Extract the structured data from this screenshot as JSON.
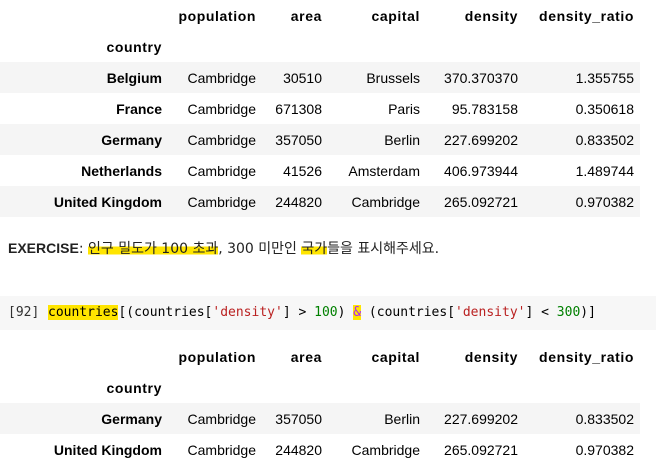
{
  "columns": [
    "population",
    "area",
    "capital",
    "density",
    "density_ratio"
  ],
  "index_name": "country",
  "table1": [
    {
      "country": "Belgium",
      "population": "Cambridge",
      "area": "30510",
      "capital": "Brussels",
      "density": "370.370370",
      "density_ratio": "1.355755"
    },
    {
      "country": "France",
      "population": "Cambridge",
      "area": "671308",
      "capital": "Paris",
      "density": "95.783158",
      "density_ratio": "0.350618"
    },
    {
      "country": "Germany",
      "population": "Cambridge",
      "area": "357050",
      "capital": "Berlin",
      "density": "227.699202",
      "density_ratio": "0.833502"
    },
    {
      "country": "Netherlands",
      "population": "Cambridge",
      "area": "41526",
      "capital": "Amsterdam",
      "density": "406.973944",
      "density_ratio": "1.489744"
    },
    {
      "country": "United Kingdom",
      "population": "Cambridge",
      "area": "244820",
      "capital": "Cambridge",
      "density": "265.092721",
      "density_ratio": "0.970382"
    }
  ],
  "exercise": {
    "label": "EXERCISE",
    "sep": ": ",
    "part1": "인구 밀도가 100 초과",
    "part2": ", 300 미만인 ",
    "part3": "국가",
    "part4": "들을 표시해주세요."
  },
  "cell": {
    "prompt": "[92]",
    "t1": "countries",
    "t2": "[(countries[",
    "s1": "'density'",
    "t3": "] > ",
    "n1": "100",
    "t4": ") ",
    "op": "&",
    "t5": " (countries[",
    "s2": "'density'",
    "t6": "] < ",
    "n2": "300",
    "t7": ")]"
  },
  "table2": [
    {
      "country": "Germany",
      "population": "Cambridge",
      "area": "357050",
      "capital": "Berlin",
      "density": "227.699202",
      "density_ratio": "0.833502"
    },
    {
      "country": "United Kingdom",
      "population": "Cambridge",
      "area": "244820",
      "capital": "Cambridge",
      "density": "265.092721",
      "density_ratio": "0.970382"
    }
  ]
}
